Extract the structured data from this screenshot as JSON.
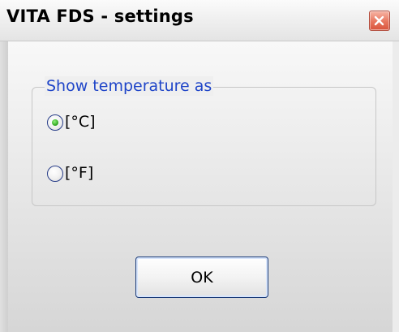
{
  "window": {
    "title": "VITA FDS - settings"
  },
  "group": {
    "label": "Show temperature as",
    "options": [
      {
        "label": "[°C]",
        "selected": true
      },
      {
        "label": "[°F]",
        "selected": false
      }
    ]
  },
  "buttons": {
    "ok_label": "OK"
  },
  "colors": {
    "group_label": "#1f45c8",
    "radio_selected": "#2ca21b",
    "close_button": "#e8765e"
  },
  "icons": {
    "close": "close-icon"
  }
}
